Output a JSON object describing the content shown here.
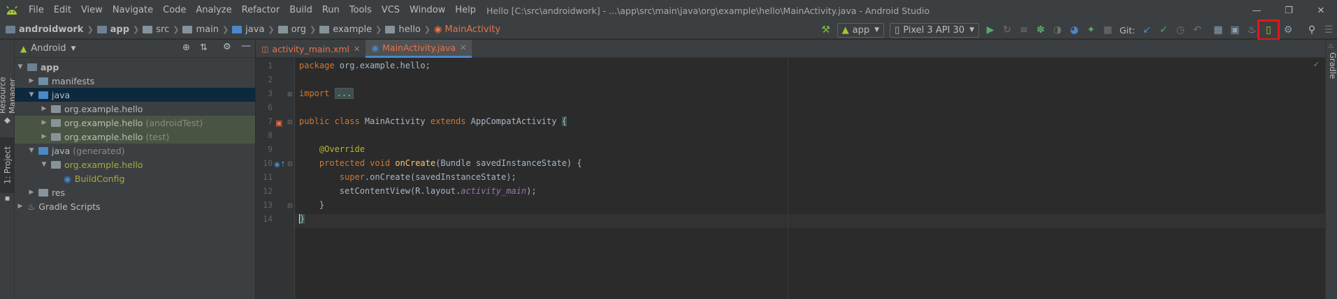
{
  "title_bar": {
    "menus": [
      {
        "label": "File"
      },
      {
        "label": "Edit"
      },
      {
        "label": "View"
      },
      {
        "label": "Navigate"
      },
      {
        "label": "Code"
      },
      {
        "label": "Analyze"
      },
      {
        "label": "Refactor"
      },
      {
        "label": "Build"
      },
      {
        "label": "Run"
      },
      {
        "label": "Tools"
      },
      {
        "label": "VCS"
      },
      {
        "label": "Window"
      },
      {
        "label": "Help"
      }
    ],
    "window_title": "Hello [C:\\src\\androidwork] - ...\\app\\src\\main\\java\\org\\example\\hello\\MainActivity.java - Android Studio"
  },
  "breadcrumbs": [
    "androidwork",
    "app",
    "src",
    "main",
    "java",
    "org",
    "example",
    "hello",
    "MainActivity"
  ],
  "toolbar": {
    "run_config": "app",
    "device": "Pixel 3 API 30",
    "git_label": "Git:"
  },
  "side_tabs": {
    "resource_manager": "Resource Manager",
    "project": "1: Project",
    "gradle": "Gradle"
  },
  "project_panel": {
    "view_mode": "Android",
    "tree": [
      {
        "label": "app",
        "suffix": ""
      },
      {
        "label": "manifests",
        "suffix": ""
      },
      {
        "label": "java",
        "suffix": ""
      },
      {
        "label": "org.example.hello",
        "suffix": ""
      },
      {
        "label": "org.example.hello",
        "suffix": "(androidTest)"
      },
      {
        "label": "org.example.hello",
        "suffix": "(test)"
      },
      {
        "label": "java",
        "suffix": "(generated)"
      },
      {
        "label": "org.example.hello",
        "suffix": ""
      },
      {
        "label": "BuildConfig",
        "suffix": ""
      },
      {
        "label": "res",
        "suffix": ""
      },
      {
        "label": "Gradle Scripts",
        "suffix": ""
      }
    ]
  },
  "editor": {
    "tabs": [
      {
        "label": "activity_main.xml",
        "active": false
      },
      {
        "label": "MainActivity.java",
        "active": true
      }
    ],
    "line_numbers": [
      "1",
      "2",
      "3",
      "6",
      "7",
      "8",
      "9",
      "10",
      "11",
      "12",
      "13",
      "14"
    ],
    "code": {
      "l1_kw": "package",
      "l1_rest": " org.example.hello;",
      "l3_kw": "import",
      "l3_fold": "...",
      "l7_kw1": "public class",
      "l7_name": " MainActivity ",
      "l7_kw2": "extends",
      "l7_rest": " AppCompatActivity ",
      "l7_brace": "{",
      "l9_ann": "@Override",
      "l10_kw": "protected void",
      "l10_fn": "onCreate",
      "l10_rest": "(Bundle savedInstanceState) {",
      "l11_kw": "super",
      "l11_rest": ".onCreate(savedInstanceState);",
      "l12_pre": "setContentView(R.layout.",
      "l12_it": "activity_main",
      "l12_post": ");",
      "l13": "}",
      "l14": "}"
    }
  },
  "colors": {
    "accent_red_highlight": "#e0181b",
    "android_green": "#a4c639",
    "active_tab_underline": "#4a88c7"
  }
}
